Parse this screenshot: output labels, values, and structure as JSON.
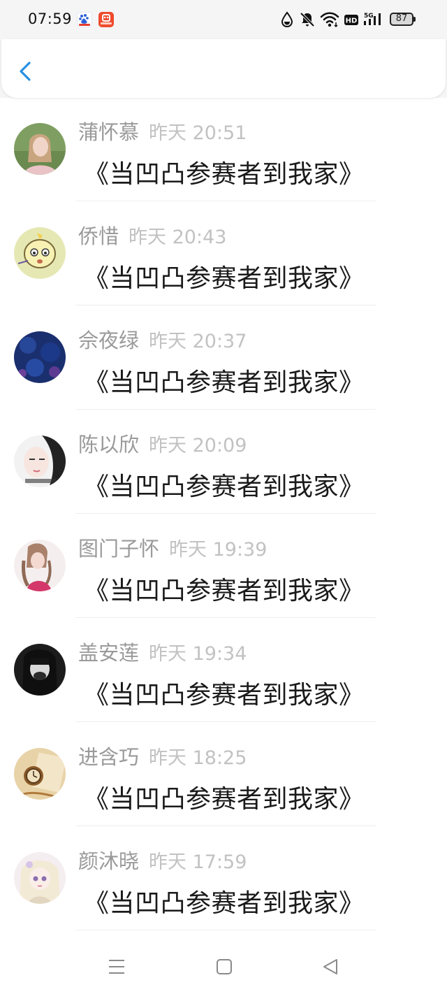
{
  "status_bar": {
    "time": "07:59",
    "battery": "87",
    "network_label": "HD",
    "network_type": "5G",
    "icons": [
      "baidu-app-icon",
      "red-app-icon",
      "water-drop-icon",
      "bell-off-icon",
      "wifi-icon",
      "hd-icon",
      "signal-icon",
      "battery-icon"
    ]
  },
  "header": {
    "back_icon": "chevron-left-icon"
  },
  "colors": {
    "accent": "#2a8fe0",
    "name_text": "#9a9a9a",
    "time_text": "#c2c2c2",
    "body_text": "#1a1a1a"
  },
  "comments": [
    {
      "name": "蒲怀慕",
      "time": "昨天 20:51",
      "text": "《当凹凸参赛者到我家》"
    },
    {
      "name": "侨惜",
      "time": "昨天 20:43",
      "text": "《当凹凸参赛者到我家》"
    },
    {
      "name": "佘夜绿",
      "time": "昨天 20:37",
      "text": "《当凹凸参赛者到我家》"
    },
    {
      "name": "陈以欣",
      "time": "昨天 20:09",
      "text": "《当凹凸参赛者到我家》"
    },
    {
      "name": "图门子怀",
      "time": "昨天 19:39",
      "text": "《当凹凸参赛者到我家》"
    },
    {
      "name": "盖安莲",
      "time": "昨天 19:34",
      "text": "《当凹凸参赛者到我家》"
    },
    {
      "name": "进含巧",
      "time": "昨天 18:25",
      "text": "《当凹凸参赛者到我家》"
    },
    {
      "name": "颜沐晓",
      "time": "昨天 17:59",
      "text": "《当凹凸参赛者到我家》"
    }
  ],
  "nav_bar": {
    "icons": [
      "menu-icon",
      "home-icon",
      "back-triangle-icon"
    ]
  }
}
